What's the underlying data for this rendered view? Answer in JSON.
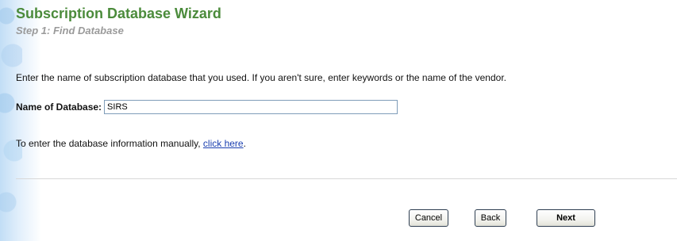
{
  "wizard": {
    "title": "Subscription Database Wizard",
    "step": "Step 1: Find Database"
  },
  "instructions": {
    "text": "Enter the name of subscription database that you used. If you aren't sure, enter keywords or the name of the vendor."
  },
  "form": {
    "database_label": "Name of Database:",
    "database_value": "SIRS"
  },
  "manual_entry": {
    "prefix": "To enter the database information manually, ",
    "link_text": "click here",
    "suffix": "."
  },
  "buttons": {
    "cancel": "Cancel",
    "back": "Back",
    "next": "Next"
  },
  "colors": {
    "title": "#4b8b3b",
    "step": "#9a9a9a",
    "link": "#1a3fb0"
  }
}
